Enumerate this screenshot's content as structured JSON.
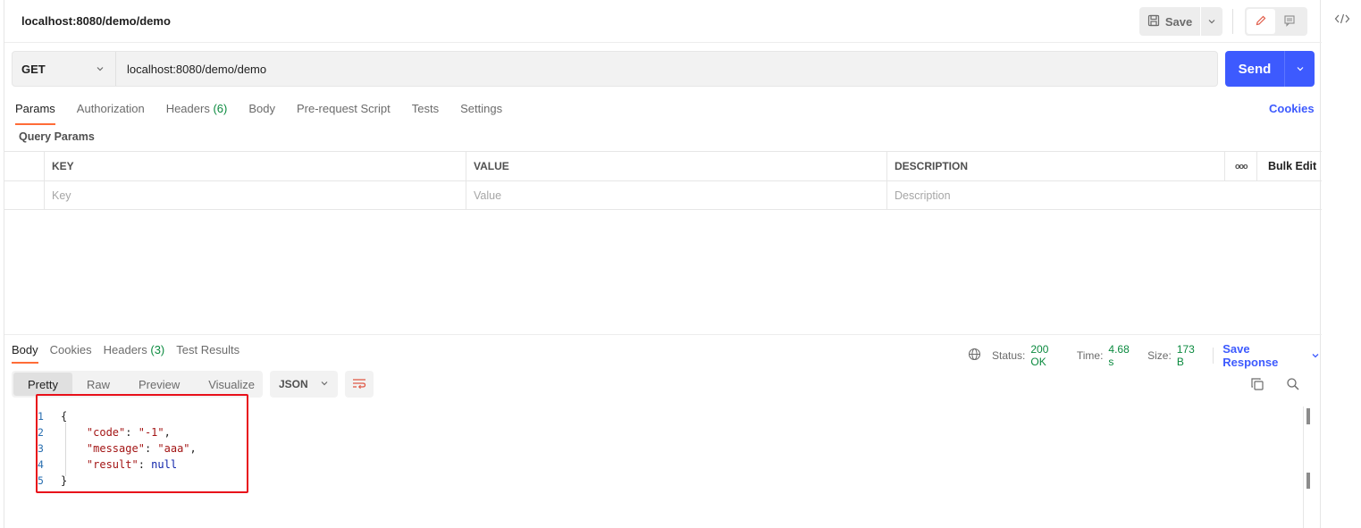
{
  "header": {
    "title": "localhost:8080/demo/demo",
    "save_label": "Save"
  },
  "request": {
    "method": "GET",
    "url": "localhost:8080/demo/demo",
    "send_label": "Send"
  },
  "tabs": {
    "params": "Params",
    "authorization": "Authorization",
    "headers": "Headers",
    "headers_count": "(6)",
    "body": "Body",
    "prerequest": "Pre-request Script",
    "tests": "Tests",
    "settings": "Settings",
    "cookies": "Cookies"
  },
  "query_params": {
    "label": "Query Params",
    "columns": {
      "key": "KEY",
      "value": "VALUE",
      "description": "DESCRIPTION",
      "bulk_edit": "Bulk Edit",
      "more": "ooo"
    },
    "placeholders": {
      "key": "Key",
      "value": "Value",
      "description": "Description"
    }
  },
  "response": {
    "tabs": {
      "body": "Body",
      "cookies": "Cookies",
      "headers": "Headers",
      "headers_count": "(3)",
      "test_results": "Test Results"
    },
    "status_label": "Status:",
    "status_value": "200 OK",
    "time_label": "Time:",
    "time_value": "4.68 s",
    "size_label": "Size:",
    "size_value": "173 B",
    "save_response": "Save Response",
    "view_tabs": {
      "pretty": "Pretty",
      "raw": "Raw",
      "preview": "Preview",
      "visualize": "Visualize"
    },
    "format": "JSON",
    "code_lines": {
      "l1": "1",
      "l2": "2",
      "l3": "3",
      "l4": "4",
      "l5": "5",
      "open": "{",
      "code_key": "\"code\"",
      "code_val": "\"-1\"",
      "message_key": "\"message\"",
      "message_val": "\"aaa\"",
      "result_key": "\"result\"",
      "result_val": "null",
      "close": "}"
    }
  },
  "colors": {
    "accent": "#3d5afe",
    "tab_underline": "#ff6c37",
    "status_ok": "#0b8a3f",
    "highlight_box": "#e8101a"
  },
  "icons": [
    "save-icon",
    "chevron-down-icon",
    "edit-icon",
    "comment-icon",
    "code-icon",
    "globe-icon",
    "wrap-lines-icon",
    "copy-icon",
    "search-icon"
  ]
}
